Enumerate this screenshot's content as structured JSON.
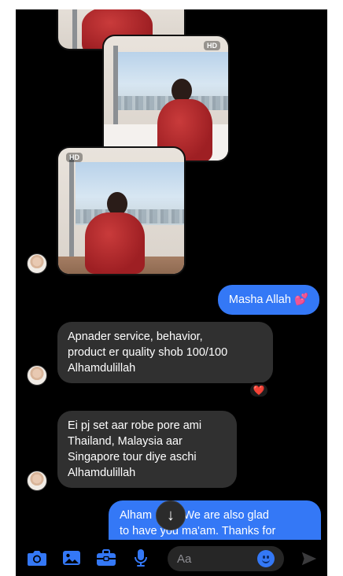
{
  "images": [
    {
      "name": "photo-top-partial",
      "hd": ""
    },
    {
      "name": "photo-window-right",
      "hd": "HD"
    },
    {
      "name": "photo-window-left",
      "hd": "HD"
    }
  ],
  "messages": [
    {
      "id": "m1",
      "direction": "outgoing",
      "text": "Masha Allah 💕"
    },
    {
      "id": "m2",
      "direction": "incoming",
      "lines": [
        "Apnader service, behavior,",
        "product er quality shob 100/100",
        "Alhamdulillah"
      ],
      "reaction": "❤️"
    },
    {
      "id": "m3",
      "direction": "incoming",
      "lines": [
        "Ei pj set aar robe pore ami",
        "Thailand, Malaysia aar",
        "Singapore tour diye aschi",
        "Alhamdulillah"
      ]
    },
    {
      "id": "m4",
      "direction": "outgoing",
      "lines": [
        "Alham    ah. We are also glad",
        "to have you ma'am. Thanks for"
      ]
    }
  ],
  "composer": {
    "placeholder": "Aa",
    "tools": [
      "camera-icon",
      "gallery-icon",
      "toolbox-icon",
      "microphone-icon"
    ],
    "emoji_icon": "smile-icon",
    "send_icon": "send-icon"
  },
  "scroll_indicator": "↓",
  "colors": {
    "outgoing": "#3478f6",
    "incoming": "#303030",
    "background": "#000000"
  }
}
